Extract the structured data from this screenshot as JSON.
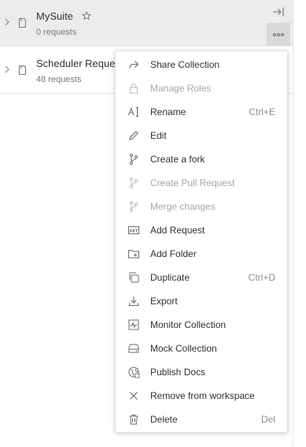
{
  "collections": [
    {
      "name": "MySuite",
      "count": "0 requests",
      "starred": true,
      "active": true
    },
    {
      "name": "Scheduler Reque",
      "count": "48 requests",
      "starred": false,
      "active": false
    }
  ],
  "sidebar": {
    "collapse_icon": "collapse-panel-icon",
    "more_icon": "more-actions-icon"
  },
  "context_menu": {
    "items": [
      {
        "label": "Share Collection",
        "shortcut": "",
        "icon": "share-icon",
        "disabled": false
      },
      {
        "label": "Manage Roles",
        "shortcut": "",
        "icon": "lock-icon",
        "disabled": true
      },
      {
        "label": "Rename",
        "shortcut": "Ctrl+E",
        "icon": "rename-icon",
        "disabled": false
      },
      {
        "label": "Edit",
        "shortcut": "",
        "icon": "pencil-icon",
        "disabled": false
      },
      {
        "label": "Create a fork",
        "shortcut": "",
        "icon": "fork-icon",
        "disabled": false
      },
      {
        "label": "Create Pull Request",
        "shortcut": "",
        "icon": "pull-request-icon",
        "disabled": true
      },
      {
        "label": "Merge changes",
        "shortcut": "",
        "icon": "merge-icon",
        "disabled": true
      },
      {
        "label": "Add Request",
        "shortcut": "",
        "icon": "get-request-icon",
        "disabled": false
      },
      {
        "label": "Add Folder",
        "shortcut": "",
        "icon": "add-folder-icon",
        "disabled": false
      },
      {
        "label": "Duplicate",
        "shortcut": "Ctrl+D",
        "icon": "duplicate-icon",
        "disabled": false
      },
      {
        "label": "Export",
        "shortcut": "",
        "icon": "export-icon",
        "disabled": false
      },
      {
        "label": "Monitor Collection",
        "shortcut": "",
        "icon": "monitor-icon",
        "disabled": false
      },
      {
        "label": "Mock Collection",
        "shortcut": "",
        "icon": "mock-server-icon",
        "disabled": false
      },
      {
        "label": "Publish Docs",
        "shortcut": "",
        "icon": "globe-icon",
        "disabled": false
      },
      {
        "label": "Remove from workspace",
        "shortcut": "",
        "icon": "close-icon",
        "disabled": false
      },
      {
        "label": "Delete",
        "shortcut": "Del",
        "icon": "trash-icon",
        "disabled": false
      }
    ]
  },
  "colors": {
    "active_row_bg": "#ececec",
    "menu_text": "#303030",
    "disabled_text": "#a6a6a6",
    "shortcut_text": "#8c8c8c"
  }
}
